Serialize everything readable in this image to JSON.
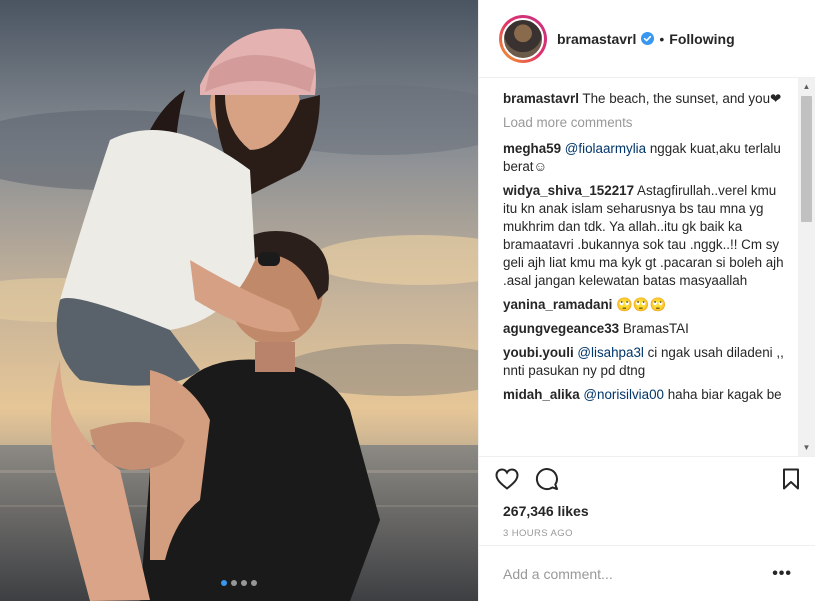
{
  "header": {
    "username": "bramastavrl",
    "verified_icon": "verified-badge-icon",
    "separator": "•",
    "follow_status": "Following"
  },
  "caption": {
    "username": "bramastavrl",
    "text": "The beach, the sunset, and you❤"
  },
  "load_more": "Load more comments",
  "comments": [
    {
      "user": "megha59",
      "mention": "@fiolaarmylia",
      "text": " nggak kuat,aku terlalu berat☺"
    },
    {
      "user": "widya_shiva_152217",
      "mention": "",
      "text": "Astagfirullah..verel kmu itu kn anak islam seharusnya bs tau mna yg mukhrim dan tdk. Ya allah..itu gk baik ka bramaatavri .bukannya sok tau .nggk..!! Cm sy geli ajh liat kmu ma kyk gt .pacaran si boleh ajh .asal jangan kelewatan batas masyaallah"
    },
    {
      "user": "yanina_ramadani",
      "mention": "",
      "text": "🙄🙄🙄"
    },
    {
      "user": "agungvegeance33",
      "mention": "",
      "text": "BramasTAI"
    },
    {
      "user": "youbi.youli",
      "mention": "@lisahpa3l",
      "text": " ci ngak usah diladeni ,, nnti pasukan ny pd dtng"
    },
    {
      "user": "midah_alika",
      "mention": "@norisilvia00",
      "text": " haha biar kagak be"
    }
  ],
  "actions": {
    "like_icon": "heart-icon",
    "comment_icon": "comment-bubble-icon",
    "save_icon": "bookmark-icon"
  },
  "likes": "267,346 likes",
  "timestamp": "3 HOURS AGO",
  "add_comment": {
    "placeholder": "Add a comment...",
    "more_label": "•••"
  },
  "carousel": {
    "count": 4,
    "active": 1
  },
  "colors": {
    "accent": "#3897f0",
    "mention": "#003569",
    "muted": "#999999",
    "border": "#efefef"
  }
}
